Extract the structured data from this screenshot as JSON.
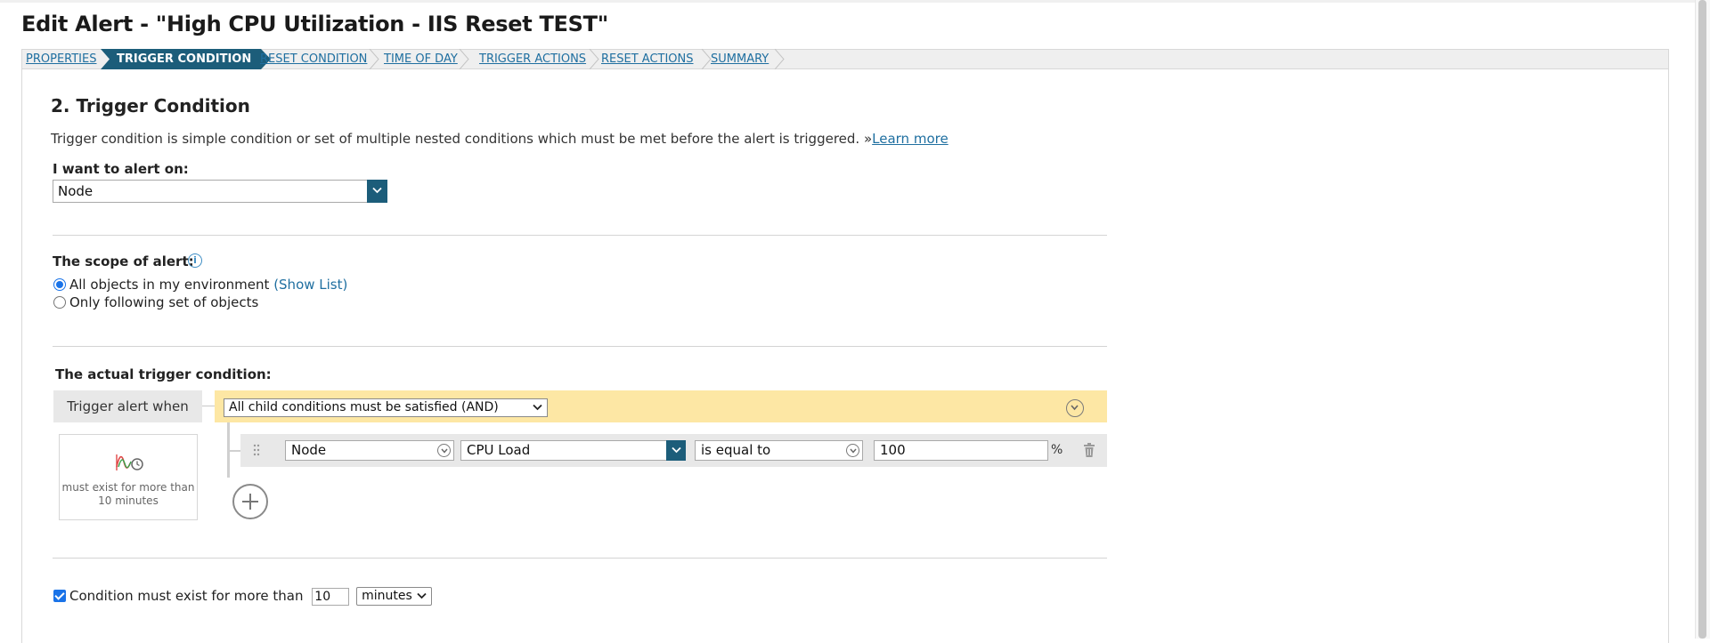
{
  "page": {
    "title": "Edit Alert - \"High CPU Utilization - IIS Reset TEST\""
  },
  "wizard": {
    "steps": [
      {
        "label": "PROPERTIES"
      },
      {
        "label": "TRIGGER CONDITION"
      },
      {
        "label": "RESET CONDITION"
      },
      {
        "label": "TIME OF DAY"
      },
      {
        "label": "TRIGGER ACTIONS"
      },
      {
        "label": "RESET ACTIONS"
      },
      {
        "label": "SUMMARY"
      }
    ],
    "active_step": "TRIGGER CONDITION"
  },
  "section": {
    "heading": "2. Trigger Condition",
    "description": "Trigger condition is simple condition or set of multiple nested conditions which must be met before the alert is triggered. »",
    "learn_more": "Learn more"
  },
  "alert_on": {
    "label": "I want to alert on:",
    "value": "Node"
  },
  "scope": {
    "label": "The scope of alert:",
    "info_icon": "info-icon",
    "options": [
      {
        "label": "All objects in my environment",
        "link": "(Show List)",
        "checked": true
      },
      {
        "label": "Only following set of objects",
        "checked": false
      }
    ]
  },
  "trigger": {
    "label": "The actual trigger condition:",
    "when_label": "Trigger alert when",
    "group_operator": "All child conditions must be satisfied (AND)",
    "duration_text": "must exist for more than 10 minutes",
    "condition": {
      "object": "Node",
      "field": "CPU Load",
      "operator": "is equal to",
      "value": "100",
      "unit": "%"
    }
  },
  "duration": {
    "checked": true,
    "label": "Condition must exist for more than",
    "value": "10",
    "unit": "minutes"
  },
  "colors": {
    "accent": "#1c5d7a",
    "link": "#1f6fa0",
    "and_bar": "#fde7a4"
  }
}
